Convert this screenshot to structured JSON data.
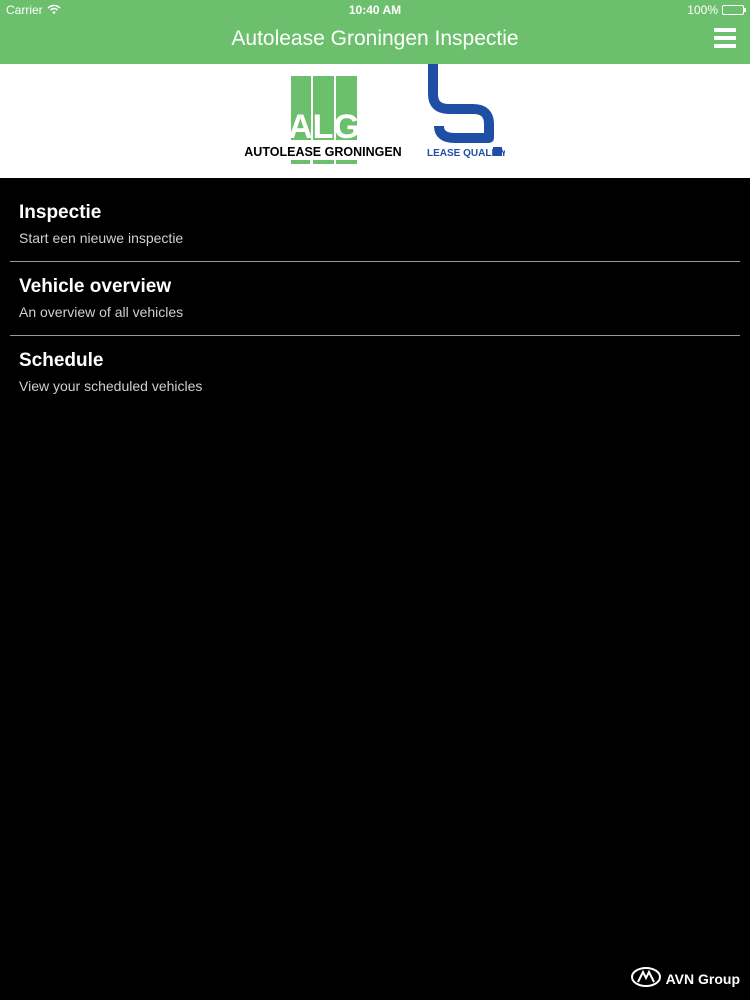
{
  "status_bar": {
    "carrier": "Carrier",
    "time": "10:40 AM",
    "battery": "100%",
    "battery_level": 1.0
  },
  "nav": {
    "title": "Autolease Groningen Inspectie",
    "menu_icon": "hamburger-menu-icon"
  },
  "logos": {
    "alg_letters": "ALG",
    "alg_name": "AUTOLEASE GRONINGEN",
    "lq_name": "LEASE QUALITY"
  },
  "menu": {
    "items": [
      {
        "title": "Inspectie",
        "subtitle": "Start een nieuwe inspectie"
      },
      {
        "title": "Vehicle overview",
        "subtitle": "An overview of all vehicles"
      },
      {
        "title": "Schedule",
        "subtitle": "View your scheduled vehicles"
      }
    ]
  },
  "footer": {
    "brand": "AVN Group"
  },
  "colors": {
    "header_green": "#6CC06D",
    "alg_green": "#6CC06D",
    "lq_blue": "#1F4FA5",
    "background": "#000000"
  }
}
